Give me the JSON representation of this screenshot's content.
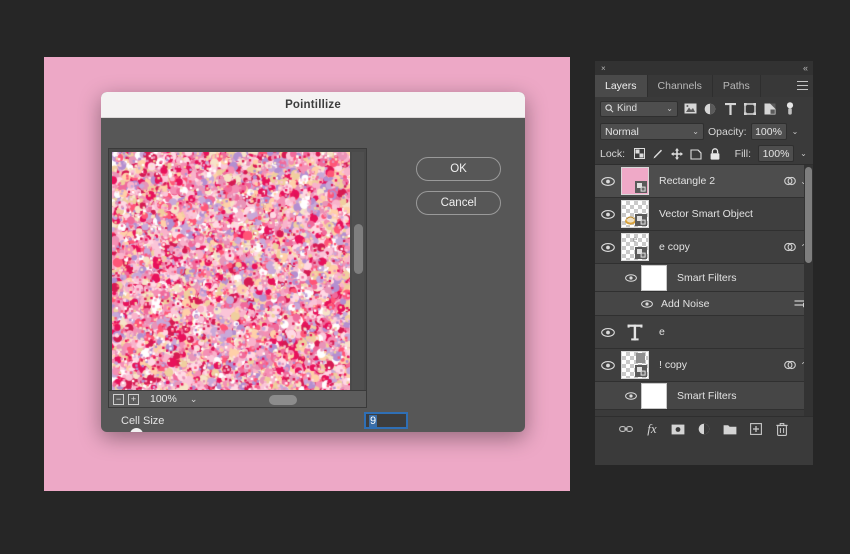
{
  "workspace": {
    "background_color": "#262626",
    "canvas_color": "#eda8c6"
  },
  "dialog": {
    "title": "Pointillize",
    "ok_label": "OK",
    "cancel_label": "Cancel",
    "zoom": {
      "minus_label": "−",
      "plus_label": "+",
      "value": "100%",
      "caret": "⌄"
    },
    "cell_size": {
      "label": "Cell Size",
      "value": "9",
      "slider_percent": 5
    }
  },
  "panel": {
    "close_icon_label": "×",
    "collapse_icon_label": "«",
    "tabs": [
      {
        "label": "Layers",
        "active": true
      },
      {
        "label": "Channels",
        "active": false
      },
      {
        "label": "Paths",
        "active": false
      }
    ],
    "filter": {
      "kind_label": "Kind",
      "caret": "⌄",
      "icons": [
        "image-filter-icon",
        "adjustment-filter-icon",
        "type-filter-icon",
        "shape-filter-icon",
        "smartobject-filter-icon",
        "toggle-filters-icon"
      ]
    },
    "blend": {
      "mode": "Normal",
      "caret": "⌄",
      "opacity_label": "Opacity:",
      "opacity_value": "100%"
    },
    "lock": {
      "label": "Lock:",
      "icons": [
        "lock-transparent-pixels-icon",
        "lock-image-pixels-icon",
        "lock-position-icon",
        "lock-artboard-nesting-icon",
        "lock-all-icon"
      ],
      "fill_label": "Fill:",
      "fill_value": "100%"
    },
    "layers": [
      {
        "name": "Rectangle 2",
        "type": "layer",
        "selected": true,
        "visible": true,
        "thumb": "pink",
        "has_fx": true,
        "chevron": "⌄"
      },
      {
        "name": "Vector Smart Object",
        "type": "layer",
        "selected": false,
        "visible": true,
        "thumb": "checker-art",
        "has_fx": false,
        "chevron": ""
      },
      {
        "name": "e copy",
        "type": "layer",
        "selected": false,
        "visible": true,
        "thumb": "checker-e",
        "has_fx": true,
        "chevron": "⌃"
      },
      {
        "name": "Smart Filters",
        "type": "smart-filters",
        "visible": true
      },
      {
        "name": "Add Noise",
        "type": "filter",
        "visible": true
      },
      {
        "name": "e",
        "type": "text-layer",
        "selected": false,
        "visible": true,
        "thumb": "type"
      },
      {
        "name": "! copy",
        "type": "layer",
        "selected": false,
        "visible": true,
        "thumb": "checker-bang",
        "has_fx": true,
        "chevron": "⌃"
      },
      {
        "name": "Smart Filters",
        "type": "smart-filters",
        "visible": true
      }
    ],
    "bottom_icons": [
      "link-layers-icon",
      "add-layer-style-icon",
      "add-layer-mask-icon",
      "new-adjustment-layer-icon",
      "new-group-icon",
      "new-layer-icon",
      "delete-layer-icon"
    ]
  }
}
